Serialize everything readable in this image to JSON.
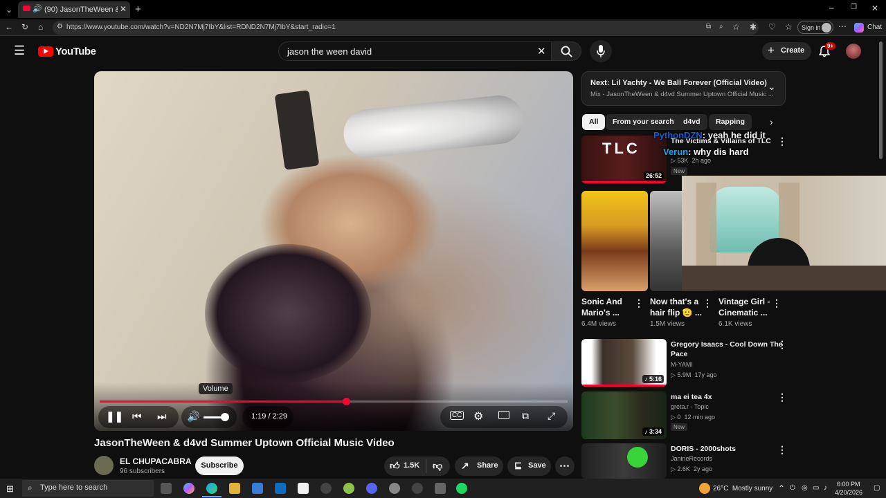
{
  "browser": {
    "tab_title": "(90) JasonTheWeen & d4vd S",
    "url": "https://www.youtube.com/watch?v=ND2N7Mj7IbY&list=RDND2N7Mj7IbY&start_radio=1",
    "sign_in": "Sign in",
    "chat": "Chat"
  },
  "youtube": {
    "logo": "YouTube",
    "search_value": "jason the ween david",
    "create": "Create",
    "notif_count": "9+"
  },
  "player": {
    "time": "1:19 / 2:29",
    "progress_fraction": 0.527,
    "volume_tooltip": "Volume",
    "volume_level": 0.85
  },
  "video": {
    "title": "JasonTheWeen & d4vd Summer Uptown Official Music Video",
    "channel": "EL CHUPACABRA",
    "subscribers": "96 subscribers",
    "subscribe": "Subscribe",
    "likes": "1.5K",
    "share": "Share",
    "save": "Save"
  },
  "sidebar": {
    "next_title": "Next: Lil Yachty - We Ball Forever (Official Video)",
    "next_sub": "Mix - JasonTheWeen & d4vd Summer Uptown Official Music ...",
    "chips": [
      "All",
      "From your search",
      "d4vd",
      "Rapping"
    ],
    "rec1": {
      "title": "The Victims & Villains of TLC",
      "views": "53K",
      "age": "2h ago",
      "badge": "New",
      "duration": "26:52",
      "thumb_text": "TLC"
    },
    "shorts": [
      {
        "title_line1": "Sonic And",
        "title_line2": "Mario's ...",
        "views": "6.4M views"
      },
      {
        "title_line1": "Now that's a",
        "title_line2": "hair flip 🫡 ...",
        "views": "1.5M views"
      },
      {
        "title_line1": "Vintage Girl -",
        "title_line2": "Cinematic ...",
        "views": "6.1K views"
      }
    ],
    "rec2": {
      "title_line1": "Gregory Isaacs - Cool Down The",
      "title_line2": "Pace",
      "channel": "M-YAMI",
      "views": "5.9M",
      "age": "17y ago",
      "duration": "5:16"
    },
    "rec3": {
      "title": "ma ei tea 4x",
      "channel": "greta.r - Topic",
      "views": "0",
      "age": "12 min ago",
      "badge": "New",
      "duration": "3:34"
    },
    "rec4": {
      "title": "DORIS - 2000shots",
      "channel": "JanineRecords",
      "views": "2.6K",
      "age": "2y ago"
    }
  },
  "overlay": {
    "chat1_user": "PythonDZN",
    "chat1_msg": ": yeah he did it",
    "chat2_user": "Verun",
    "chat2_msg": ": why dis hard"
  },
  "taskbar": {
    "search_placeholder": "Type here to search",
    "weather": "26°C  Mostly sunny",
    "time": "6:00 PM",
    "date": "4/20/2026"
  },
  "colors": {
    "accent": "#ff0033",
    "background": "#0f0f0f"
  }
}
